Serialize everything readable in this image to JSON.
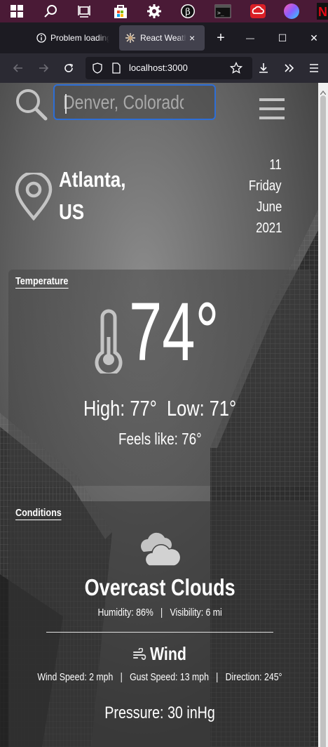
{
  "browser": {
    "tabs": [
      {
        "title": "Problem loading page",
        "active": false
      },
      {
        "title": "React Weather App",
        "active": true
      }
    ],
    "new_tab_label": "+",
    "tab_close_glyph": "×",
    "window_buttons": {
      "minimize": "—",
      "maximize": "☐",
      "close": "✕"
    },
    "url": "localhost:3000"
  },
  "taskbar": {
    "icons": [
      "windows-start-icon",
      "search-icon",
      "task-view-icon",
      "store-icon",
      "settings-icon",
      "app-icon",
      "terminal-icon",
      "creative-cloud-icon",
      "color-app-icon",
      "netflix-icon"
    ],
    "netflix_letter": "N"
  },
  "search": {
    "placeholder": "Denver, Colorado",
    "value": ""
  },
  "location": {
    "city": "Atlanta,",
    "country": "US"
  },
  "date": {
    "day": "11",
    "weekday": "Friday",
    "month": "June",
    "year": "2021"
  },
  "temperature": {
    "section_title": "Temperature",
    "current": "74°",
    "high": "High: 77°",
    "low": "Low: 71°",
    "feels_like": "Feels like: 76°"
  },
  "conditions": {
    "section_title": "Conditions",
    "description": "Overcast Clouds",
    "humidity": "Humidity: 86%",
    "visibility": "Visibility: 6 mi",
    "separator": "|",
    "wind_title": "Wind",
    "wind_speed": "Wind Speed: 2 mph",
    "gust_speed": "Gust Speed: 13 mph",
    "direction": "Direction: 245°",
    "pressure": "Pressure: 30 inHg"
  },
  "colors": {
    "taskbar": "#4a1a36",
    "tabstrip": "#1c1b22",
    "navbar": "#2b2a33",
    "search_border": "#2d6ed6",
    "card_background": "#3a3a3a"
  }
}
